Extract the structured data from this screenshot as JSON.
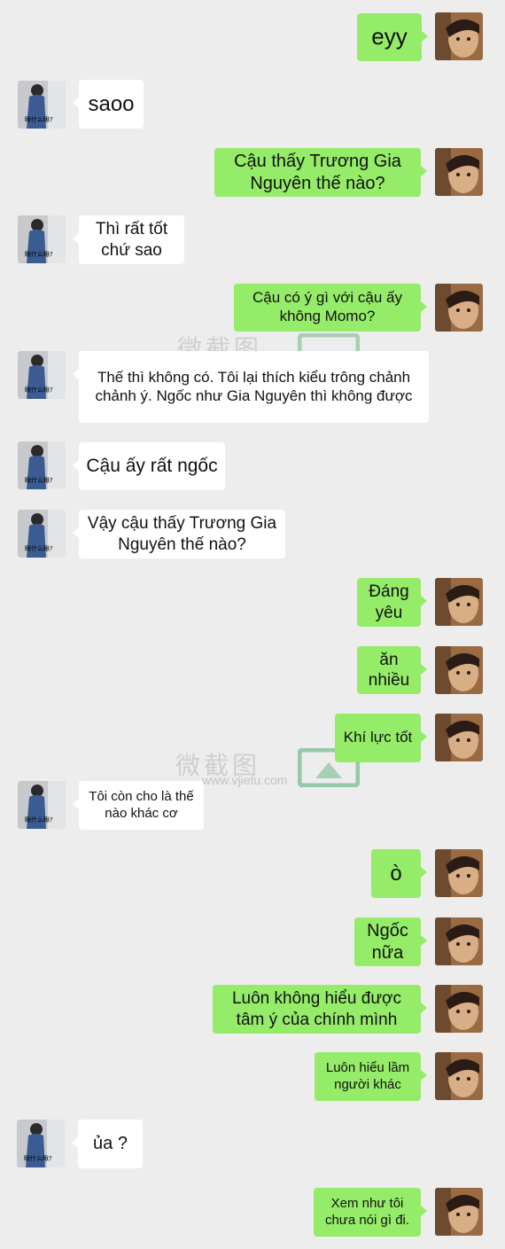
{
  "colors": {
    "sent_bubble": "#95ec69",
    "received_bubble": "#ffffff",
    "background": "#ededed"
  },
  "watermark": {
    "url": "www.vjietu.com"
  },
  "messages": [
    {
      "side": "right",
      "text": "eyy"
    },
    {
      "side": "left",
      "text": "saoo"
    },
    {
      "side": "right",
      "text": "Cậu thấy Trương Gia Nguyên thế nào?"
    },
    {
      "side": "left",
      "text": "Thì rất tốt chứ sao"
    },
    {
      "side": "right",
      "text": "Cậu có ý gì với cậu ấy không Momo?"
    },
    {
      "side": "left",
      "text": "Thế thì không có. Tôi lại thích kiểu trông chảnh chảnh ý. Ngốc như Gia Nguyên thì không được"
    },
    {
      "side": "left",
      "text": "Cậu ấy rất ngốc"
    },
    {
      "side": "left",
      "text": "Vậy cậu thấy Trương Gia Nguyên thế nào?"
    },
    {
      "side": "right",
      "text": "Đáng yêu"
    },
    {
      "side": "right",
      "text": "ăn nhiều"
    },
    {
      "side": "right",
      "text": "Khí lực tốt"
    },
    {
      "side": "left",
      "text": "Tôi còn cho là thế nào khác cơ"
    },
    {
      "side": "right",
      "text": "ò"
    },
    {
      "side": "right",
      "text": "Ngốc nữa"
    },
    {
      "side": "right",
      "text": "Luôn không hiểu được tâm ý của chính mình"
    },
    {
      "side": "right",
      "text": "Luôn hiểu lầm người khác"
    },
    {
      "side": "left",
      "text": "ủa ?"
    },
    {
      "side": "right",
      "text": "Xem như tôi chưa nói gì đi."
    }
  ]
}
